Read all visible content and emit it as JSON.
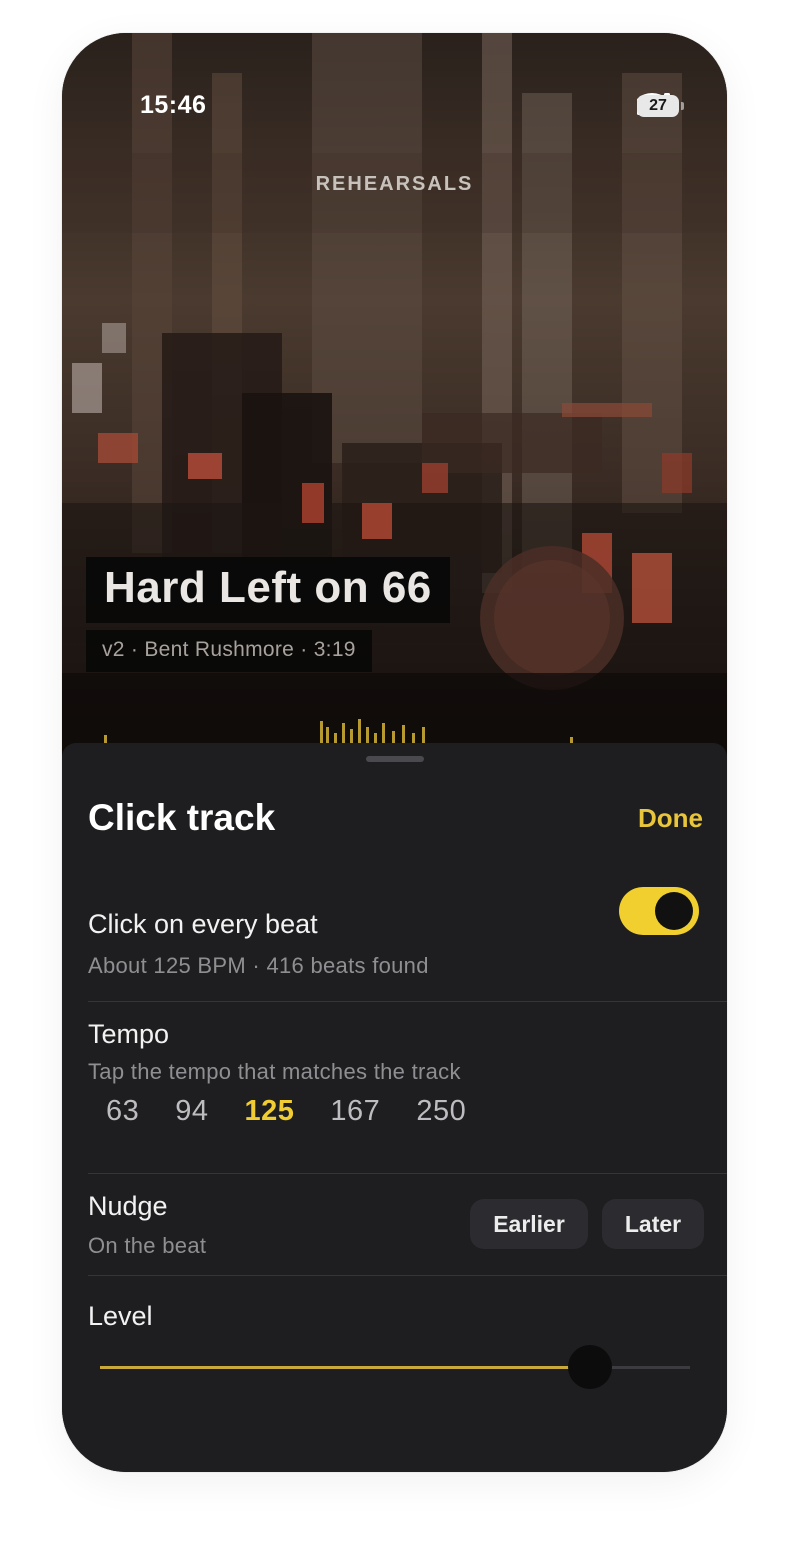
{
  "status_bar": {
    "time": "15:46",
    "battery": "27"
  },
  "nav": {
    "title": "REHEARSALS"
  },
  "track": {
    "title": "Hard Left on 66",
    "meta": "v2 · Bent Rushmore · 3:19"
  },
  "sheet": {
    "title": "Click track",
    "done_label": "Done",
    "click_every_beat": {
      "label": "Click on every beat",
      "sub": "About 125 BPM · 416 beats found",
      "enabled": true
    },
    "tempo": {
      "label": "Tempo",
      "sub": "Tap the tempo that matches the track",
      "options": [
        "63",
        "94",
        "125",
        "167",
        "250"
      ],
      "selected": "125"
    },
    "nudge": {
      "label": "Nudge",
      "sub": "On the beat",
      "earlier_label": "Earlier",
      "later_label": "Later"
    },
    "level": {
      "label": "Level",
      "value": 0.83
    }
  },
  "colors": {
    "accent": "#f0cd32",
    "sheet_bg": "#1e1e20"
  }
}
